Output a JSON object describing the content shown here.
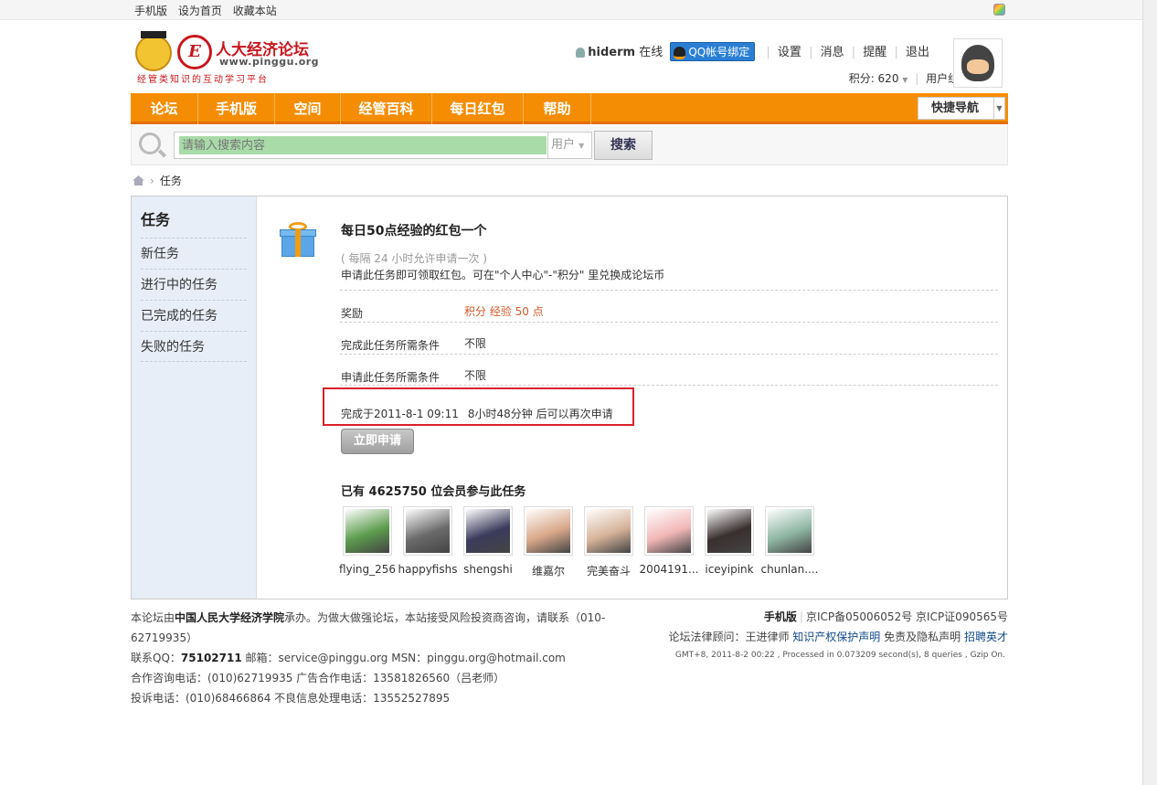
{
  "topbar": {
    "links": [
      "手机版",
      "设为首页",
      "收藏本站"
    ]
  },
  "logo": {
    "emblem": "E",
    "name": "人大经济论坛",
    "url": "www.pinggu.org",
    "slogan": "经管类知识的互动学习平台"
  },
  "user": {
    "name": "hiderm",
    "status": "在线",
    "qq_bind": "QQ帐号绑定",
    "links": [
      "设置",
      "消息",
      "提醒",
      "退出"
    ],
    "credits_label": "积分: 620",
    "group_label": "用户组: 副教授"
  },
  "nav": {
    "items": [
      "论坛",
      "手机版",
      "空间",
      "经管百科",
      "每日红包",
      "帮助"
    ],
    "quick_nav": "快捷导航"
  },
  "search": {
    "placeholder": "请输入搜索内容",
    "type": "用户",
    "button": "搜索"
  },
  "breadcrumb": {
    "current": "任务"
  },
  "sidebar": {
    "title": "任务",
    "items": [
      "新任务",
      "进行中的任务",
      "已完成的任务",
      "失败的任务"
    ]
  },
  "task": {
    "title": "每日50点经验的红包一个",
    "interval": "( 每隔  24  小时允许申请一次  )",
    "description": "申请此任务即可领取红包。可在\"个人中心\"-\"积分\" 里兑换成论坛币",
    "rows": [
      {
        "key": "奖励",
        "value": "积分  经验  50 点"
      },
      {
        "key": "完成此任务所需条件",
        "value": "不限"
      },
      {
        "key": "申请此任务所需条件",
        "value": "不限"
      }
    ],
    "completed": "完成于2011-8-1 09:11",
    "reapply": "8小时48分钟  后可以再次申请",
    "apply_button": "立即申请",
    "participants": "已有  4625750 位会员参与此任务",
    "members": [
      {
        "name": "flying_256",
        "color": "#5d9c4e"
      },
      {
        "name": "happyfishs",
        "color": "#6a6a6a"
      },
      {
        "name": "shengshi",
        "color": "#3b3b5c"
      },
      {
        "name": "维嘉尔",
        "color": "#d9a88a"
      },
      {
        "name": "完美奋斗",
        "color": "#d6b39a"
      },
      {
        "name": "2004191...",
        "color": "#f2b6b6"
      },
      {
        "name": "iceyipink",
        "color": "#3a2f2f"
      },
      {
        "name": "chunlan....",
        "color": "#8fb6a4"
      }
    ]
  },
  "footer": {
    "left": [
      {
        "pre": "本论坛由",
        "bold": "中国人民大学经济学院",
        "post": "承办。为做大做强论坛，本站接受风险投资商咨询，请联系（010-62719935）"
      },
      {
        "pre": "联系QQ：",
        "bold": "75102711",
        "post": " 邮箱：service@pinggu.org MSN：pinggu.org@hotmail.com"
      },
      {
        "pre": "合作咨询电话：(010)62719935 广告合作电话：13581826560（吕老师）",
        "bold": "",
        "post": ""
      },
      {
        "pre": "投诉电话：(010)68466864 不良信息处理电话：13552527895",
        "bold": "",
        "post": ""
      }
    ],
    "mobile": "手机版",
    "icp1": "京ICP备05006052号",
    "icp2": "京ICP证090565号",
    "legal": "论坛法律顾问：王进律师",
    "ip_statement": "知识产权保护声明",
    "disclaimer": "免责及隐私声明",
    "jobs": "招聘英才",
    "stats": "GMT+8, 2011-8-2 00:22 , Processed in 0.073209 second(s), 8 queries , Gzip On."
  }
}
